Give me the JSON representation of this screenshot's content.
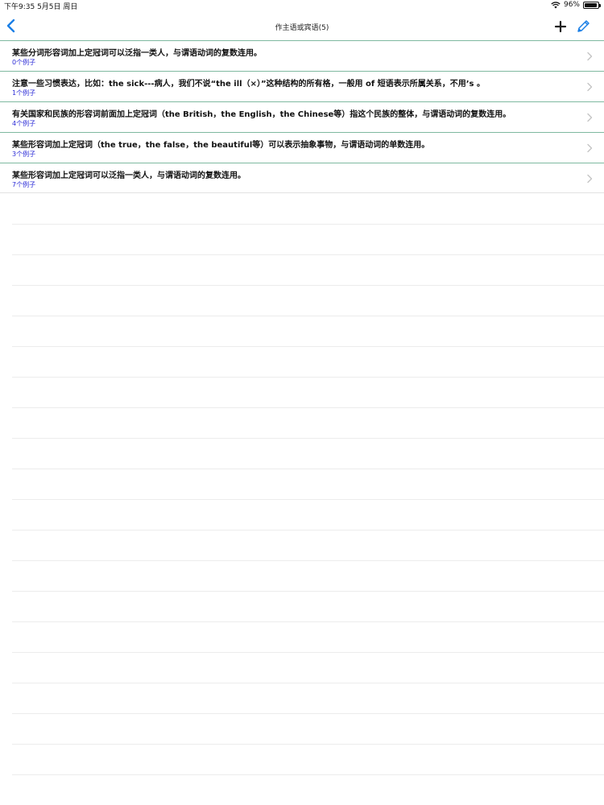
{
  "status_bar": {
    "time_date": "下午9:35   5月5日 周日",
    "battery_text": "96%",
    "battery_level": 0.96
  },
  "nav": {
    "title": "作主语或宾语(5)",
    "back_icon": "chevron-left-icon",
    "add_icon": "plus-icon",
    "edit_icon": "pencil-icon",
    "accent_color": "#1a7fe6"
  },
  "items": [
    {
      "title": "某些分词形容词加上定冠词可以泛指一类人，与谓语动词的复数连用。",
      "count": "0个例子"
    },
    {
      "title": "注意一些习惯表达，比如：the sick---病人，我们不说“the ill（×）”这种结构的所有格，一般用 of 短语表示所属关系，不用’s 。",
      "count": "1个例子"
    },
    {
      "title": "有关国家和民族的形容词前面加上定冠词（the British，the English，the Chinese等）指这个民族的整体，与谓语动词的复数连用。",
      "count": "4个例子"
    },
    {
      "title": "某些形容词加上定冠词（the true，the false，the beautiful等）可以表示抽象事物，与谓语动词的单数连用。",
      "count": "3个例子"
    },
    {
      "title": "某些形容词加上定冠词可以泛指一类人，与谓语动词的复数连用。",
      "count": "7个例子"
    }
  ]
}
